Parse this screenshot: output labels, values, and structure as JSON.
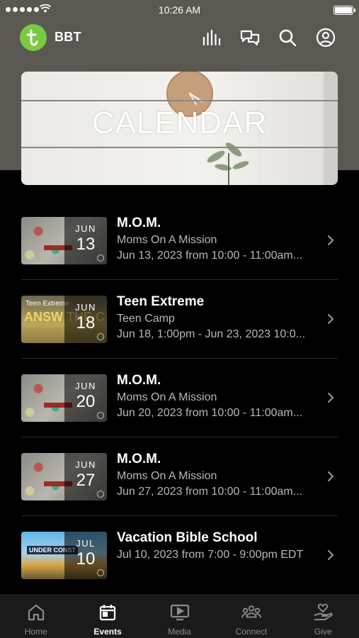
{
  "status_bar": {
    "time": "10:26 AM"
  },
  "header": {
    "app_name": "BBT"
  },
  "hero": {
    "title": "CALENDAR"
  },
  "events": [
    {
      "title": "M.O.M.",
      "subtitle": "Moms On A Mission",
      "date": "Jun 13, 2023 from 10:00 - 11:00am...",
      "month": "JUN",
      "day": "13",
      "thumb": "mom"
    },
    {
      "title": "Teen Extreme",
      "subtitle": "Teen Camp",
      "date": "Jun 18, 1:00pm - Jun 23, 2023 10:0...",
      "month": "JUN",
      "day": "18",
      "thumb": "teen",
      "thumb_text": "Teen Extreme",
      "thumb_big": "ANSW THE C"
    },
    {
      "title": "M.O.M.",
      "subtitle": "Moms On A Mission",
      "date": "Jun 20, 2023 from 10:00 - 11:00am...",
      "month": "JUN",
      "day": "20",
      "thumb": "mom"
    },
    {
      "title": "M.O.M.",
      "subtitle": "Moms On A Mission",
      "date": "Jun 27, 2023 from 10:00 - 11:00am...",
      "month": "JUN",
      "day": "27",
      "thumb": "mom"
    },
    {
      "title": "Vacation Bible School",
      "subtitle": "",
      "date": "Jul 10, 2023 from 7:00 - 9:00pm EDT",
      "month": "JUL",
      "day": "10",
      "thumb": "vbs",
      "thumb_text": "UNDER CONST"
    }
  ],
  "tabs": [
    {
      "label": "Home",
      "icon": "home-icon",
      "active": false
    },
    {
      "label": "Events",
      "icon": "calendar-icon",
      "active": true
    },
    {
      "label": "Media",
      "icon": "media-icon",
      "active": false
    },
    {
      "label": "Connect",
      "icon": "people-icon",
      "active": false
    },
    {
      "label": "Give",
      "icon": "give-icon",
      "active": false
    }
  ],
  "colors": {
    "brand_green": "#7ac943",
    "header_bg": "#5b5852",
    "background": "#000000",
    "tabbar_bg": "#1a1a1a"
  }
}
